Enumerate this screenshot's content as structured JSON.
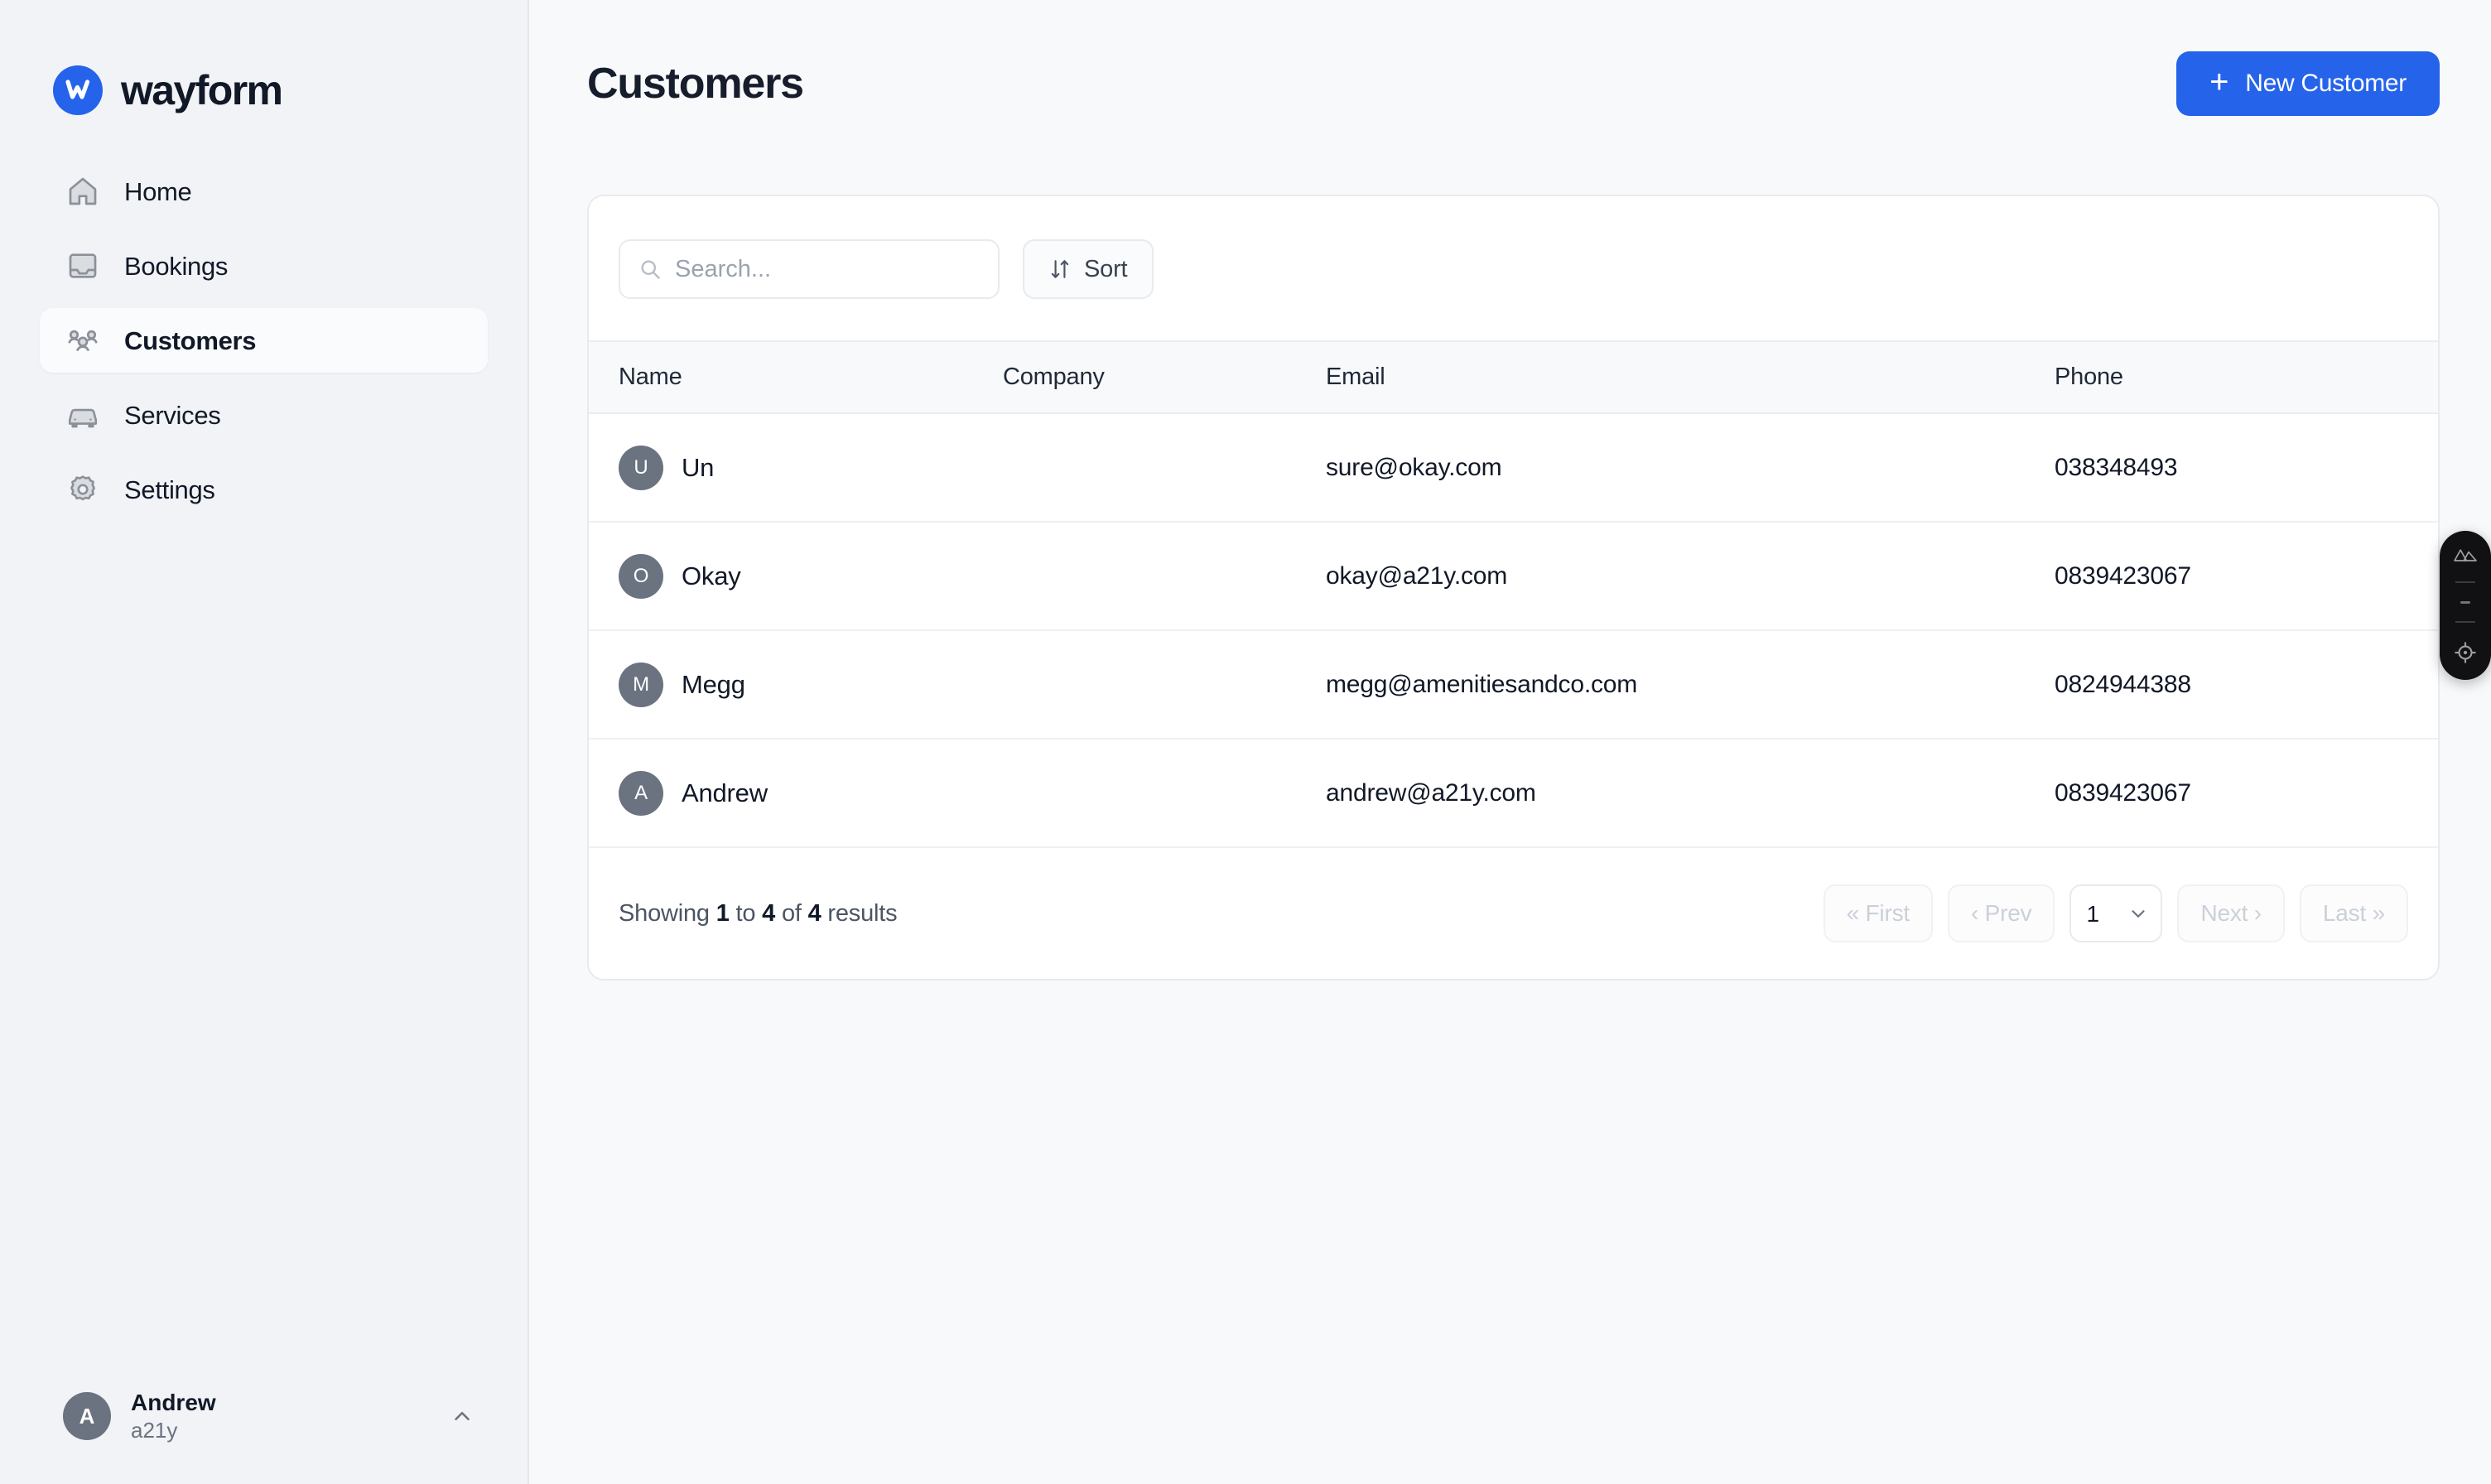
{
  "brand": {
    "name": "wayform",
    "logo_icon": "wayform-w-mark",
    "accent_color": "#2563eb"
  },
  "sidebar": {
    "items": [
      {
        "label": "Home",
        "icon": "home-icon",
        "active": false
      },
      {
        "label": "Bookings",
        "icon": "inbox-icon",
        "active": false
      },
      {
        "label": "Customers",
        "icon": "users-icon",
        "active": true
      },
      {
        "label": "Services",
        "icon": "car-icon",
        "active": false
      },
      {
        "label": "Settings",
        "icon": "gear-icon",
        "active": false
      }
    ],
    "user": {
      "initial": "A",
      "name": "Andrew",
      "org": "a21y",
      "chevron_icon": "chevron-up-icon"
    }
  },
  "header": {
    "title": "Customers",
    "new_customer_label": "New Customer",
    "new_customer_icon": "plus-icon"
  },
  "toolbar": {
    "search_placeholder": "Search...",
    "search_value": "",
    "search_icon": "search-icon",
    "sort_label": "Sort",
    "sort_icon": "sort-arrows-icon"
  },
  "table": {
    "columns": [
      "Name",
      "Company",
      "Email",
      "Phone"
    ],
    "rows": [
      {
        "initial": "U",
        "name": "Un",
        "company": "",
        "email": "sure@okay.com",
        "phone": "038348493"
      },
      {
        "initial": "O",
        "name": "Okay",
        "company": "",
        "email": "okay@a21y.com",
        "phone": "0839423067"
      },
      {
        "initial": "M",
        "name": "Megg",
        "company": "",
        "email": "megg@amenitiesandco.com",
        "phone": "0824944388"
      },
      {
        "initial": "A",
        "name": "Andrew",
        "company": "",
        "email": "andrew@a21y.com",
        "phone": "0839423067"
      }
    ]
  },
  "footer": {
    "showing_prefix": "Showing",
    "showing_from": "1",
    "showing_mid": "to",
    "showing_to": "4",
    "showing_of": "of",
    "showing_total": "4",
    "showing_suffix": "results",
    "first_label": "« First",
    "prev_label": "‹ Prev",
    "page_value": "1",
    "next_label": "Next ›",
    "last_label": "Last »"
  },
  "devtools": {
    "top_icon": "nuxt-logo-icon",
    "bottom_icon": "crosshair-target-icon"
  }
}
